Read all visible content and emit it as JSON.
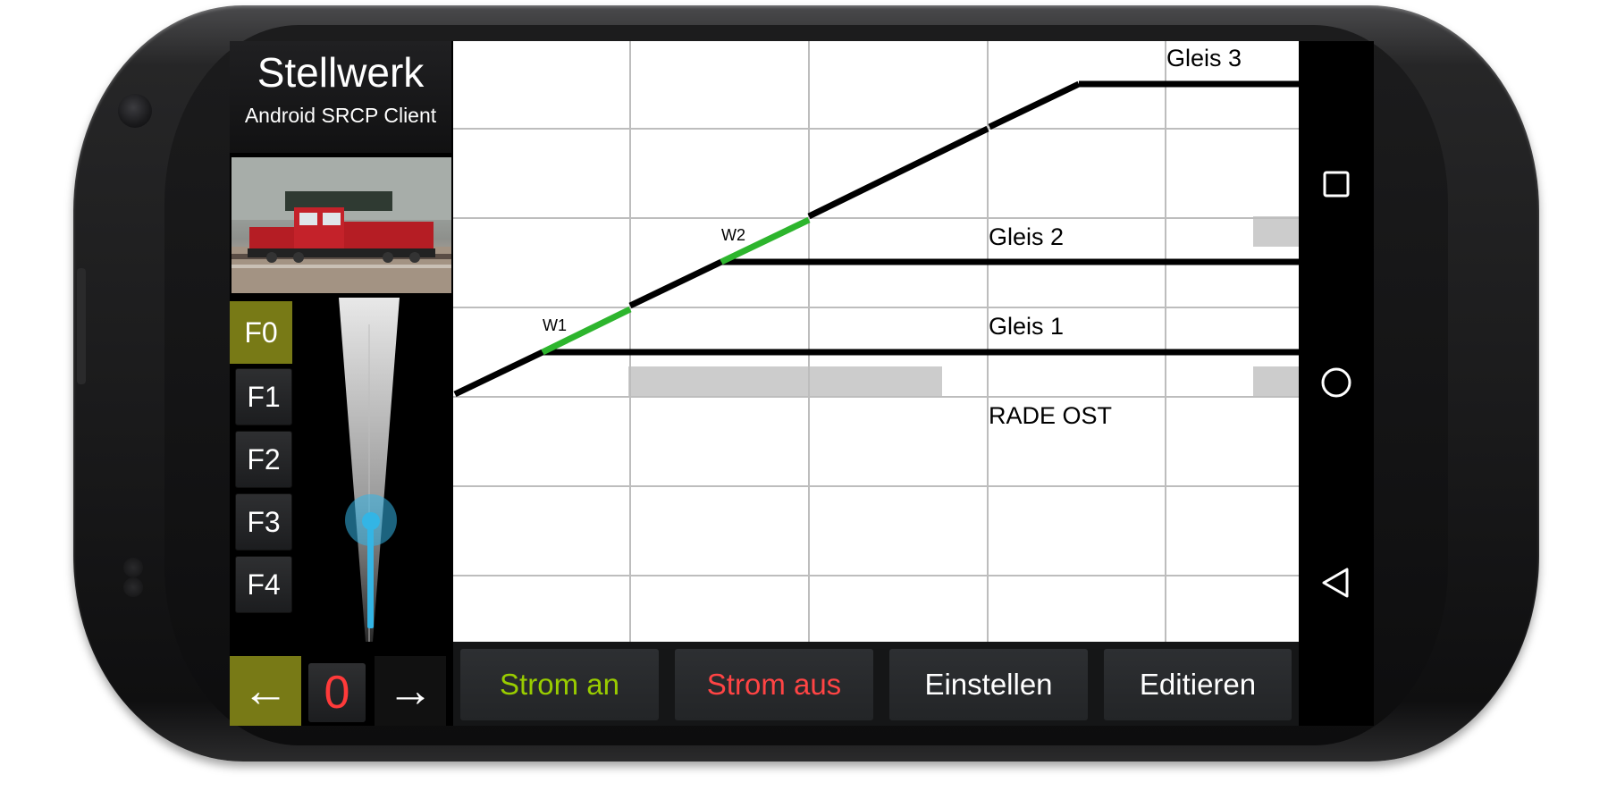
{
  "app": {
    "title": "Stellwerk",
    "subtitle": "Android SRCP Client"
  },
  "throttle": {
    "function_buttons": [
      {
        "label": "F0",
        "active": true
      },
      {
        "label": "F1",
        "active": false
      },
      {
        "label": "F2",
        "active": false
      },
      {
        "label": "F3",
        "active": false
      },
      {
        "label": "F4",
        "active": false
      }
    ],
    "speed_value": "0",
    "speed_slider_level": 0.3,
    "direction_left": "←",
    "direction_right": "→",
    "direction_active": "left"
  },
  "track_diagram": {
    "tracks": [
      "Gleis 3",
      "Gleis 2",
      "Gleis 1"
    ],
    "station": "RADE OST",
    "switches": [
      {
        "label": "W1",
        "state": "diverging"
      },
      {
        "label": "W2",
        "state": "diverging"
      }
    ]
  },
  "actions": {
    "power_on": "Strom an",
    "power_off": "Strom aus",
    "settings": "Einstellen",
    "edit": "Editieren"
  },
  "colors": {
    "accent_olive": "#787a16",
    "switch_green": "#2db52d",
    "power_on": "#99cc00",
    "power_off": "#ff4444",
    "slider_blue": "#33b5e5",
    "occupied_grey": "#cccccc"
  },
  "navigation": {
    "icons": [
      "recent-apps-icon",
      "home-icon",
      "back-icon"
    ]
  }
}
